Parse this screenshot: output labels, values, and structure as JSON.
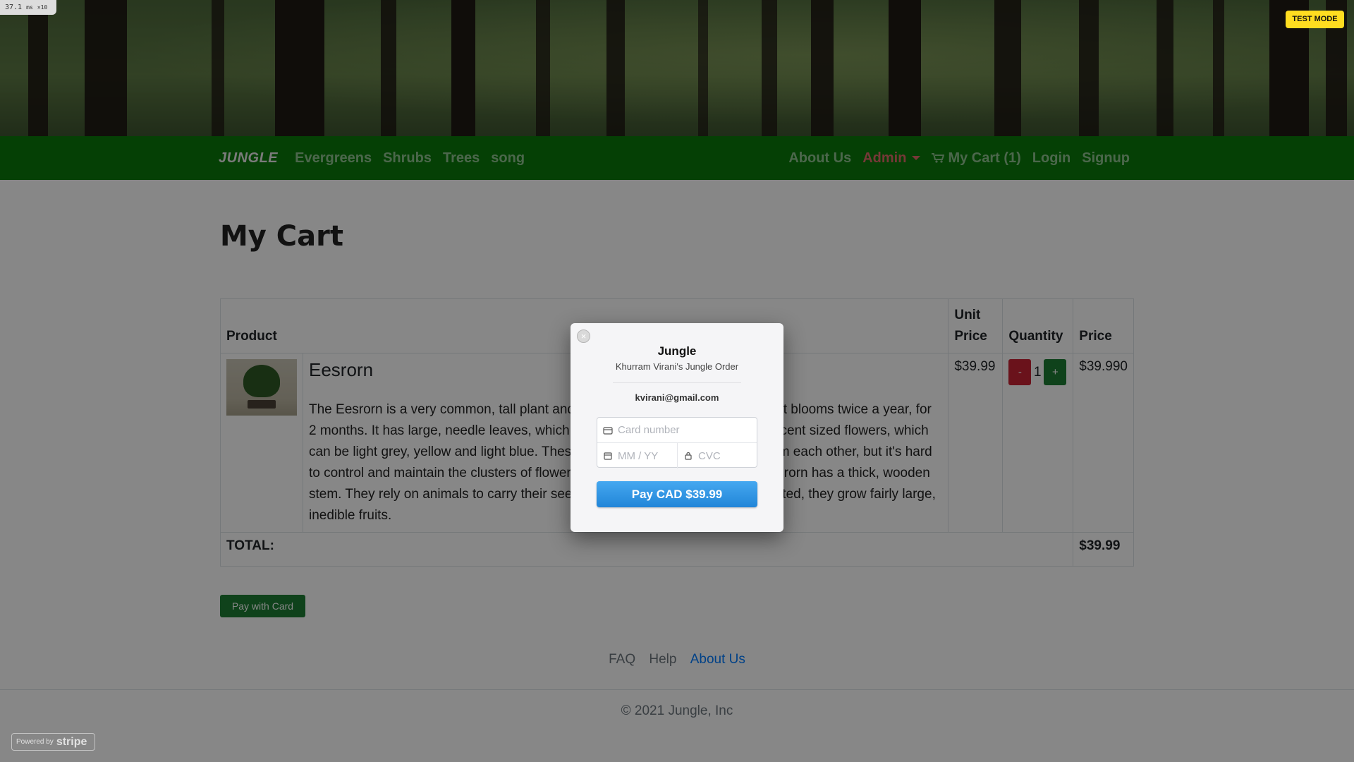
{
  "perf_badge": {
    "value": "37.1",
    "unit": "ms",
    "multiplier": "×10"
  },
  "navbar": {
    "brand": "JUNGLE",
    "left_links": [
      "Evergreens",
      "Shrubs",
      "Trees",
      "song"
    ],
    "about": "About Us",
    "admin": "Admin",
    "cart": "My Cart (1)",
    "login": "Login",
    "signup": "Signup"
  },
  "page_title": "My Cart",
  "table": {
    "headers": {
      "product": "Product",
      "unit_price": "Unit Price",
      "quantity": "Quantity",
      "price": "Price"
    },
    "rows": [
      {
        "name": "Eesrorn",
        "description": "The Eesrorn is a very common, tall plant and can be found in some mountains. It blooms twice a year, for 2 months. It has large, needle leaves, which are usually purple. It also grows decent sized flowers, which can be light grey, yellow and light blue. These flowers grow in a fair distance from each other, but it's hard to control and maintain the clusters of flowers. As a defense mechanism the Eesrorn has a thick, wooden stem. They rely on animals to carry their seeds away to reproduce. Once pollinated, they grow fairly large, inedible fruits.",
        "unit_price": "$39.99",
        "quantity": "1",
        "minus_label": "-",
        "plus_label": "+",
        "price": "$39.990"
      }
    ],
    "total_label": "TOTAL:",
    "total_value": "$39.99"
  },
  "pay_with_card": "Pay with Card",
  "footer": {
    "links": [
      "FAQ",
      "Help",
      "About Us"
    ],
    "copyright": "© 2021 Jungle, Inc"
  },
  "test_mode": "TEST MODE",
  "stripe_badge": {
    "powered_by": "Powered by",
    "brand": "stripe"
  },
  "modal": {
    "close_glyph": "×",
    "title": "Jungle",
    "subtitle": "Khurram Virani's Jungle Order",
    "email": "kvirani@gmail.com",
    "card_number_placeholder": "Card number",
    "expiry_placeholder": "MM / YY",
    "cvc_placeholder": "CVC",
    "pay_button": "Pay CAD $39.99"
  },
  "colors": {
    "navbar": "#0b7a0b",
    "pay_button": "#2185d8",
    "minus": "#c82333",
    "plus": "#1e7e34",
    "test_mode": "#ffdd20",
    "active_link": "#007bff"
  },
  "icons": [
    "cart-icon",
    "caret-down-icon",
    "card-icon",
    "calendar-icon",
    "lock-icon",
    "close-icon"
  ]
}
